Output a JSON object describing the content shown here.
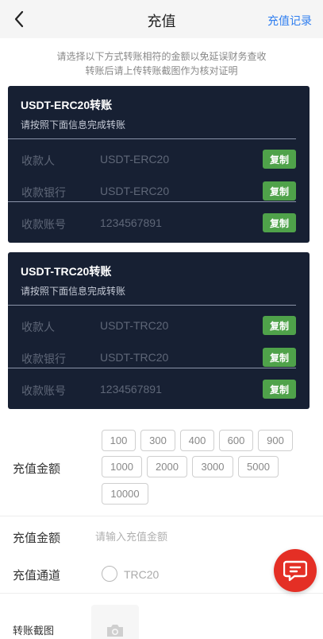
{
  "header": {
    "title": "充值",
    "records_link": "充值记录"
  },
  "notice": {
    "line1": "请选择以下方式转账相符的金额以免延误财务查收",
    "line2": "转账后请上传转账截图作为核对证明"
  },
  "cards": [
    {
      "title": "USDT-ERC20转账",
      "subtitle": "请按照下面信息完成转账",
      "rows": [
        {
          "label": "收款人",
          "value": "USDT-ERC20",
          "copy": "复制"
        },
        {
          "label": "收款银行",
          "value": "USDT-ERC20",
          "copy": "复制"
        },
        {
          "label": "收款账号",
          "value": "1234567891",
          "copy": "复制"
        }
      ]
    },
    {
      "title": "USDT-TRC20转账",
      "subtitle": "请按照下面信息完成转账",
      "rows": [
        {
          "label": "收款人",
          "value": "USDT-TRC20",
          "copy": "复制"
        },
        {
          "label": "收款银行",
          "value": "USDT-TRC20",
          "copy": "复制"
        },
        {
          "label": "收款账号",
          "value": "1234567891",
          "copy": "复制"
        }
      ]
    }
  ],
  "form": {
    "amount_label": "充值金额",
    "amounts": [
      "100",
      "300",
      "400",
      "600",
      "900",
      "1000",
      "2000",
      "3000",
      "5000",
      "10000"
    ],
    "amount_input_label": "充值金额",
    "amount_input_placeholder": "请输入充值金额",
    "channel_label": "充值通道",
    "channel_option": "TRC20",
    "screenshot_label": "转账截图"
  },
  "icons": {
    "back": "chevron-left-icon",
    "chat": "chat-icon",
    "camera": "camera-icon"
  },
  "colors": {
    "card_bg": "#172033",
    "copy_btn": "#4fa24a",
    "link": "#2f7ef0",
    "chat_fab": "#e42f25"
  }
}
